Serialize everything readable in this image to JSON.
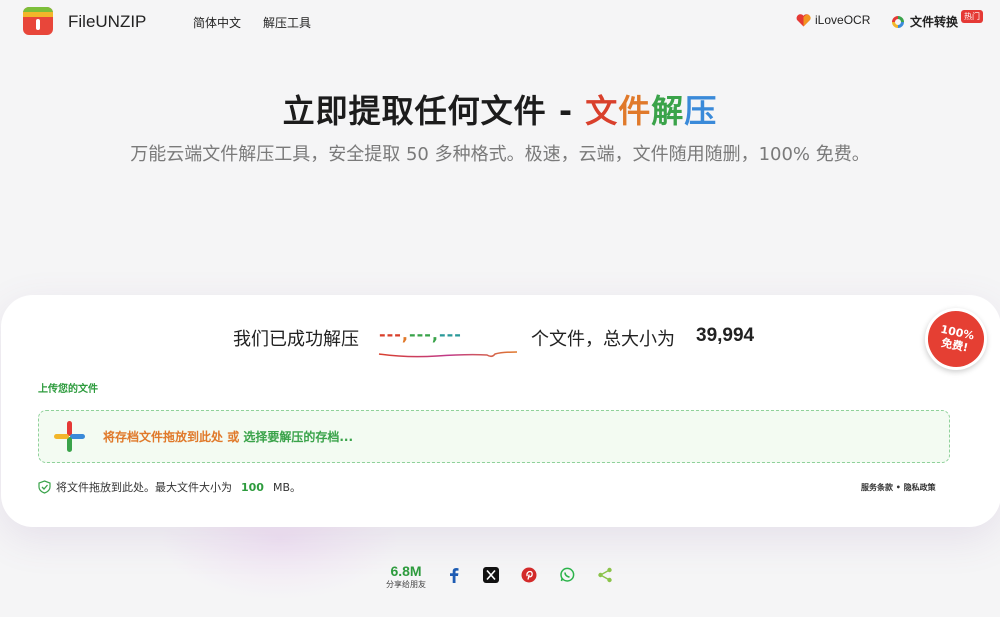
{
  "header": {
    "brand": "FileUNZIP",
    "nav": [
      "简体中文",
      "解压工具"
    ],
    "right_links": [
      {
        "label": "iLoveOCR",
        "icon": "heart-icon"
      },
      {
        "label": "文件转换",
        "icon": "convert-icon",
        "badge": "热门"
      }
    ]
  },
  "hero": {
    "title_main": "立即提取任何文件 - ",
    "title_accent": [
      "文",
      "件",
      "解",
      "压"
    ],
    "subtitle": "万能云端文件解压工具，安全提取 50 多种格式。极速，云端，文件随用随删，100% 免费。"
  },
  "stats": {
    "prefix": "我们已成功解压",
    "count_parts": [
      "---",
      ",",
      "---",
      ",",
      "---"
    ],
    "suffix": "个文件，总大小为",
    "size": "39,994"
  },
  "badge": {
    "line1": "100%",
    "line2": "免费!"
  },
  "upload": {
    "label": "上传您的文件",
    "drop_text_1": "将存档文件拖放到此处",
    "drop_text_or": " 或 ",
    "drop_text_2": "选择要解压的存档...",
    "info_prefix": "将文件拖放到此处。最大文件大小为",
    "info_size": "100",
    "info_unit": "MB。",
    "terms": "服务条款",
    "sep": " • ",
    "privacy": "隐私政策"
  },
  "share": {
    "count": "6.8M",
    "label": "分享给朋友",
    "buttons": [
      "facebook-icon",
      "x-icon",
      "pinterest-icon",
      "whatsapp-icon",
      "share-icon"
    ]
  },
  "colors": {
    "green": "#2d9b3d",
    "orange": "#e0792a",
    "red": "#d9402c",
    "blue": "#3a8ad9"
  }
}
